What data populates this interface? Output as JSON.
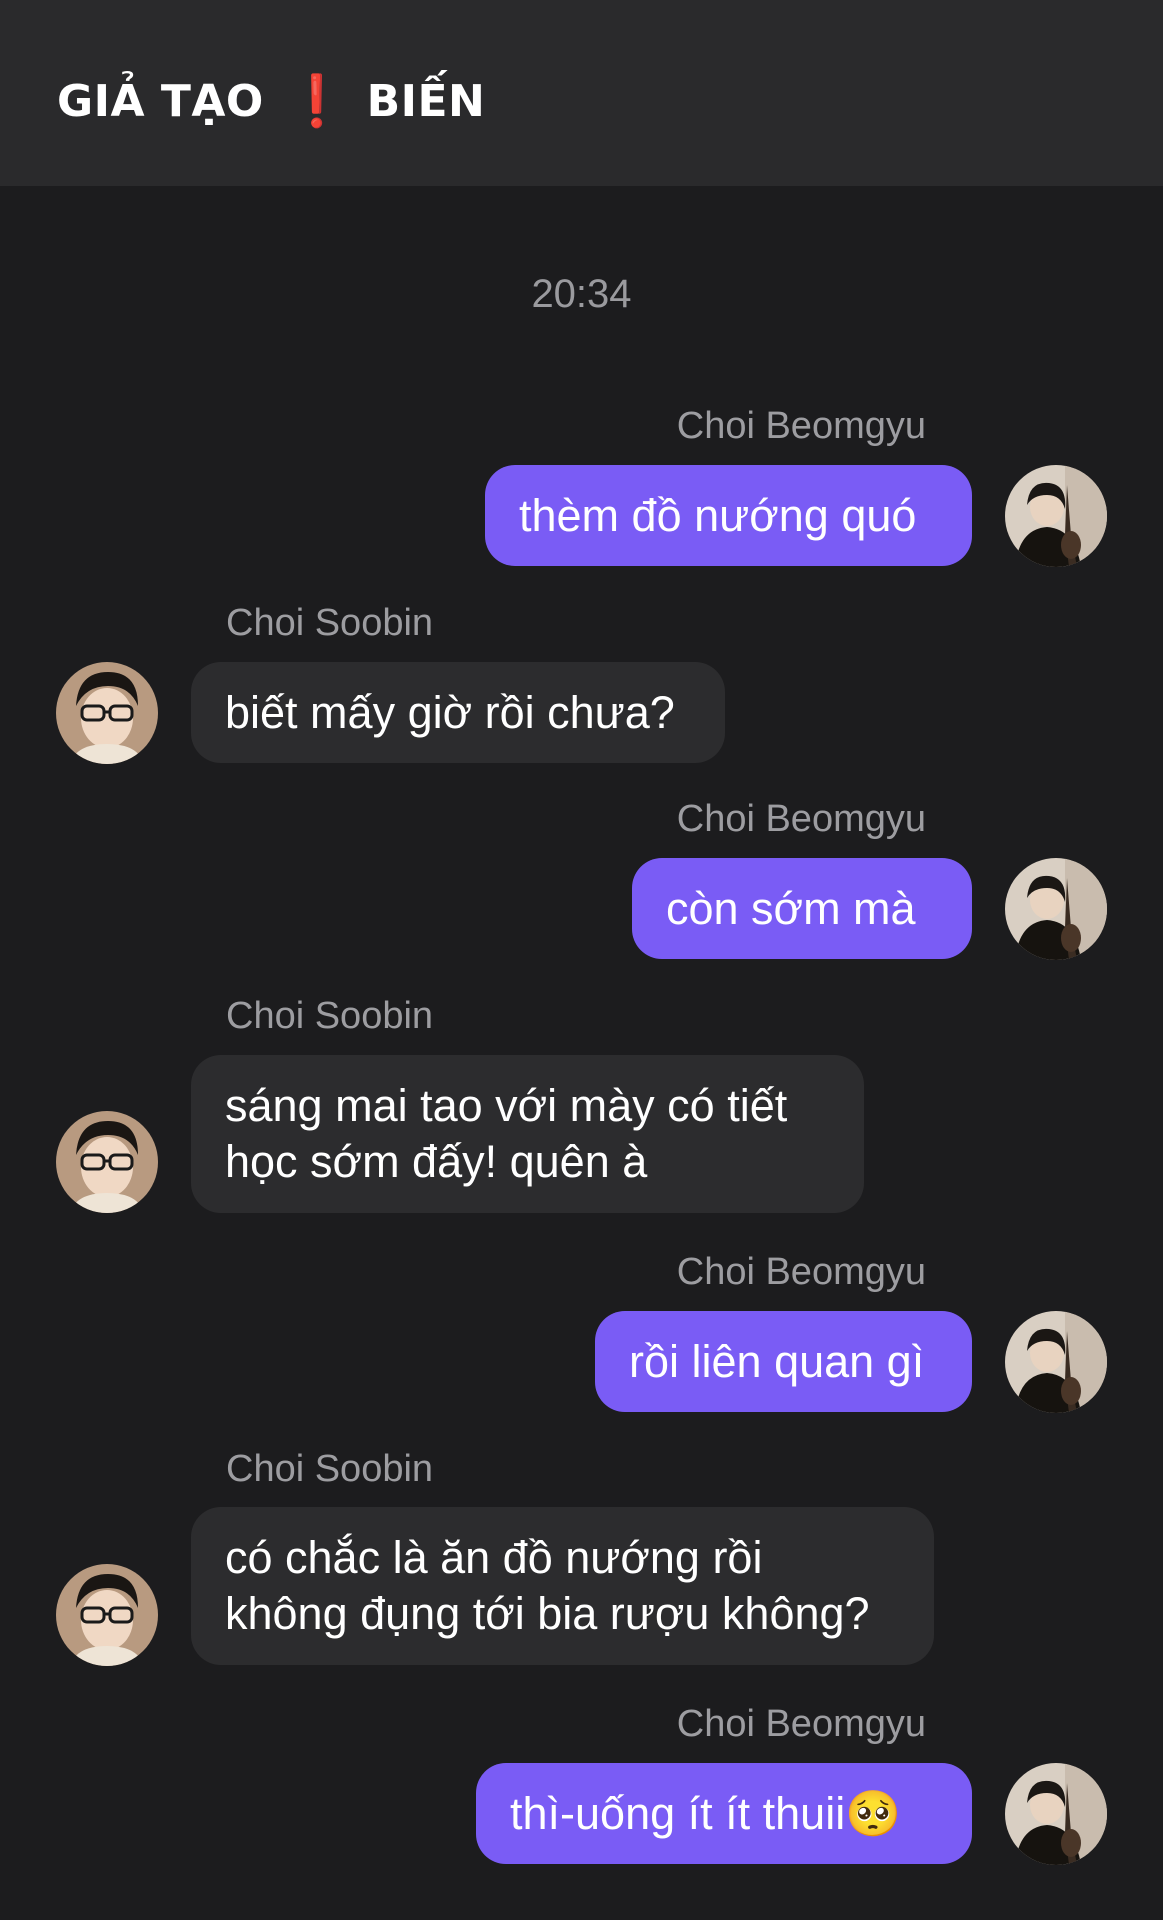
{
  "header": {
    "title_left": "GIẢ TẠO",
    "title_icon": "exclamation-icon",
    "title_right": "BIẾN",
    "accent": "#e5322d"
  },
  "timestamp": "20:34",
  "colors": {
    "outgoing_bubble": "#7a5cf5",
    "incoming_bubble": "#2c2c2e",
    "background": "#1c1c1e",
    "header_background": "#2a2a2c"
  },
  "messages": [
    {
      "sender": "Choi Beomgyu",
      "direction": "outgoing",
      "lines": [
        "thèm đồ nướng quó"
      ]
    },
    {
      "sender": "Choi Soobin",
      "direction": "incoming",
      "lines": [
        "biết mấy giờ rồi chưa?"
      ]
    },
    {
      "sender": "Choi Beomgyu",
      "direction": "outgoing",
      "lines": [
        "còn sớm mà"
      ]
    },
    {
      "sender": "Choi Soobin",
      "direction": "incoming",
      "lines": [
        "sáng mai tao với mày có tiết",
        "học sớm đấy! quên à"
      ]
    },
    {
      "sender": "Choi Beomgyu",
      "direction": "outgoing",
      "lines": [
        "rồi liên quan gì"
      ]
    },
    {
      "sender": "Choi Soobin",
      "direction": "incoming",
      "lines": [
        "có chắc là ăn đồ nướng rồi",
        "không đụng tới bia rượu không?"
      ]
    },
    {
      "sender": "Choi Beomgyu",
      "direction": "outgoing",
      "lines": [
        "thì-uống ít ít thuii🥺"
      ]
    }
  ]
}
